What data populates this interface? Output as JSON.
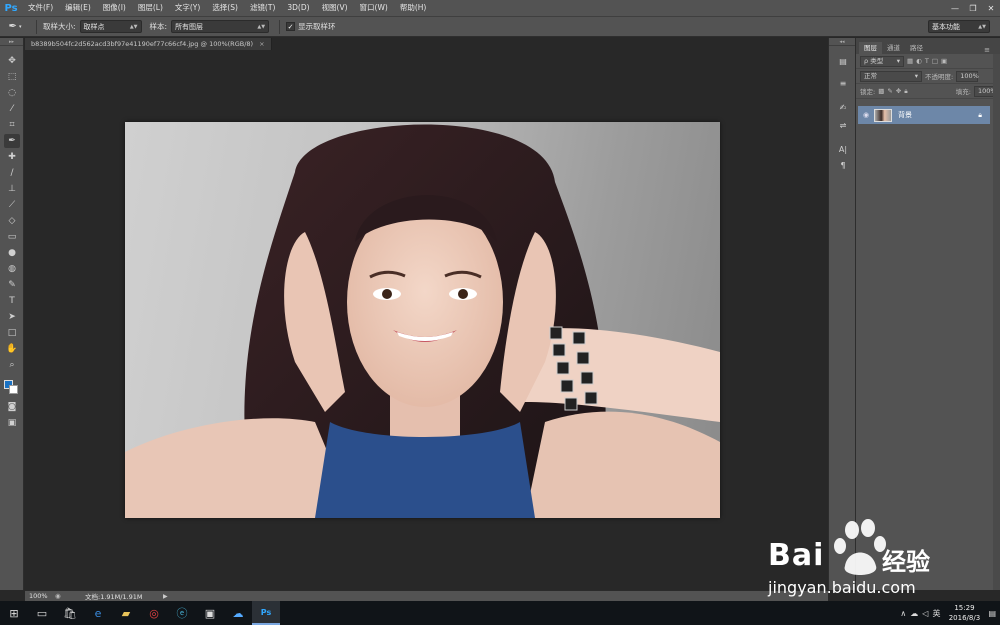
{
  "app": {
    "logo": "Ps",
    "accent": "#31a8ff"
  },
  "menu": [
    "文件(F)",
    "编辑(E)",
    "图像(I)",
    "图层(L)",
    "文字(Y)",
    "选择(S)",
    "滤镜(T)",
    "3D(D)",
    "视图(V)",
    "窗口(W)",
    "帮助(H)"
  ],
  "options": {
    "sample_size_label": "取样大小:",
    "sample_size_value": "取样点",
    "sample_label": "样本:",
    "sample_value": "所有图层",
    "show_ring_label": "显示取样环",
    "show_ring_checked": "✓",
    "workspace": "基本功能"
  },
  "document": {
    "tab": "b8389b504fc2d562acd3bf97e41190ef77c66cf4.jpg @ 100%(RGB/8)",
    "close": "×"
  },
  "status": {
    "zoom": "100%",
    "doc_info": "文档:1.91M/1.91M"
  },
  "layers_panel": {
    "tabs": [
      "图层",
      "通道",
      "路径"
    ],
    "filter_kind": "ρ 类型",
    "blend_mode": "正常",
    "opacity_label": "不透明度:",
    "opacity_value": "100%",
    "lock_label": "锁定:",
    "fill_label": "填充:",
    "fill_value": "100%",
    "layer_name": "背景"
  },
  "taskbar": {
    "time": "15:29",
    "date": "2016/8/3",
    "ime": "英"
  },
  "watermark": {
    "brand": "Bai",
    "brand_cn": "经验",
    "url": "jingyan.baidu.com",
    "color": "#ffffff"
  },
  "colors": {
    "foreground": "#1a72c4",
    "background": "#ffffff",
    "dress": "#2b4f8c"
  }
}
